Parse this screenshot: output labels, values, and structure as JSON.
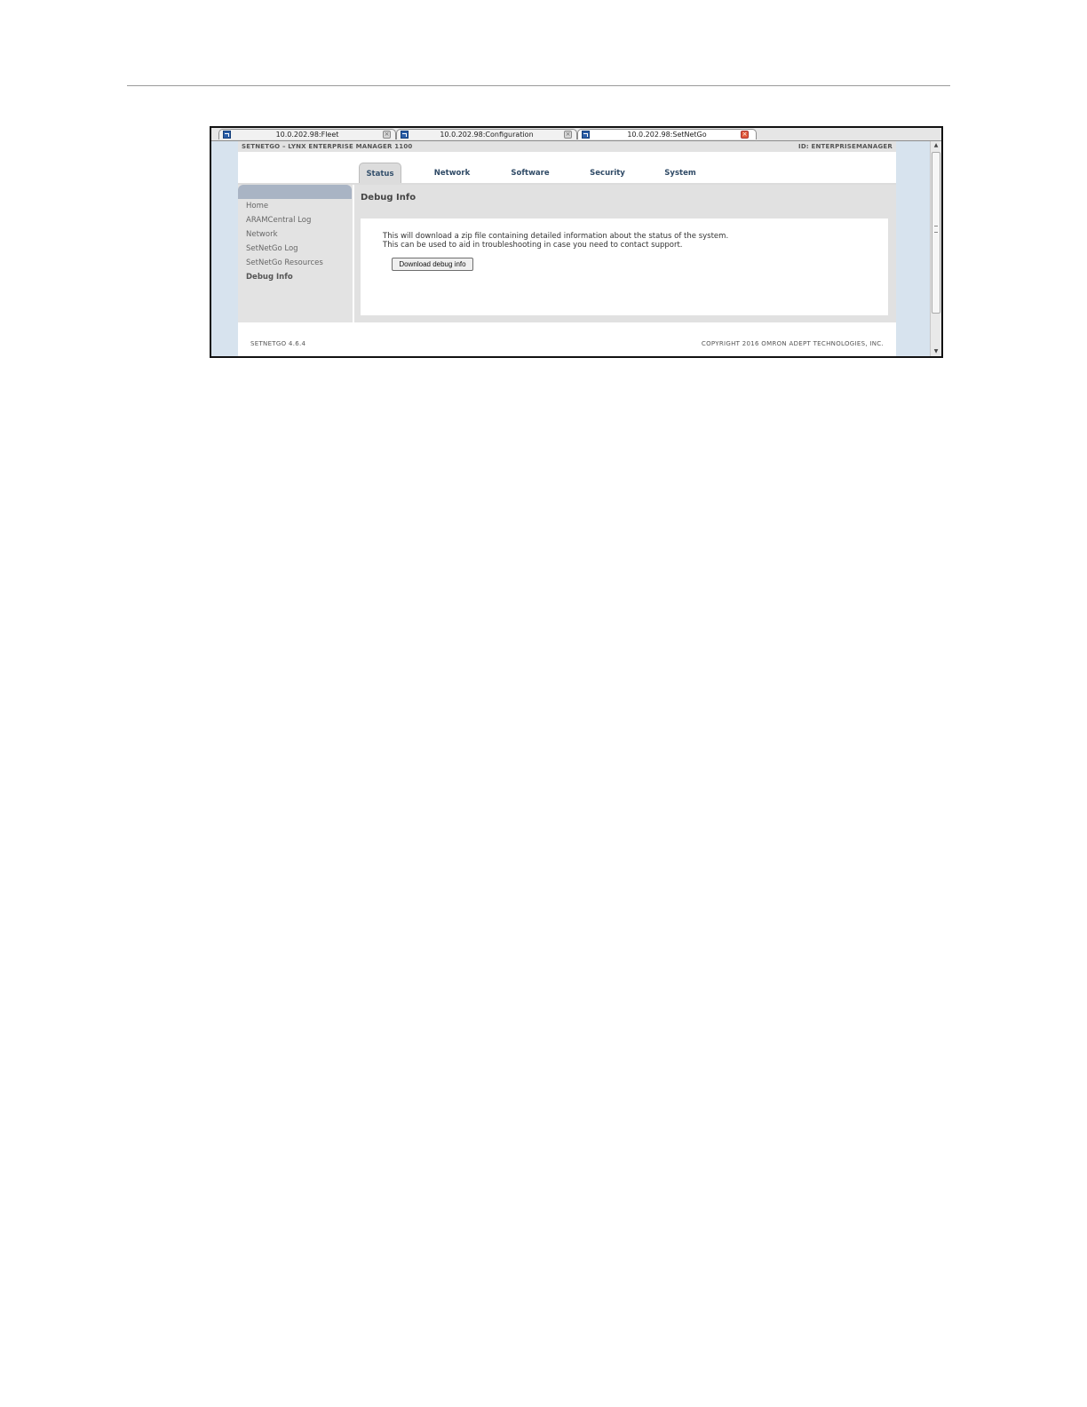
{
  "browser": {
    "tabs": [
      {
        "title": "10.0.202.98:Fleet",
        "active": false
      },
      {
        "title": "10.0.202.98:Configuration",
        "active": false
      },
      {
        "title": "10.0.202.98:SetNetGo",
        "active": true
      }
    ]
  },
  "app": {
    "header_left": "SETNETGO – LYNX ENTERPRISE MANAGER 1100",
    "header_right": "ID: ENTERPRISEMANAGER",
    "nav_tabs": [
      "Status",
      "Network",
      "Software",
      "Security",
      "System"
    ],
    "active_tab": "Status",
    "sidebar": {
      "items": [
        "Home",
        "ARAMCentral Log",
        "Network",
        "SetNetGo Log",
        "SetNetGo Resources",
        "Debug Info"
      ],
      "selected": "Debug Info"
    },
    "page_title": "Debug Info",
    "description_line1": "This will download a zip file containing detailed information about the status of the system.",
    "description_line2": "This can be used to aid in troubleshooting in case you need to contact support.",
    "download_button": "Download debug info",
    "footer_version": "SETNETGO 4.6.4",
    "footer_copyright": "COPYRIGHT 2016 OMRON ADEPT TECHNOLOGIES, INC."
  },
  "colors": {
    "background_frame": "#d7e3ee",
    "nav_text": "#2f4a66",
    "sidebar_header": "#a9b4c4",
    "active_close": "#e2583a"
  },
  "icons": {
    "tab_favicon": "app-favicon-icon",
    "tab_close": "close-icon",
    "scroll_up": "arrow-up-icon",
    "scroll_down": "arrow-down-icon"
  }
}
